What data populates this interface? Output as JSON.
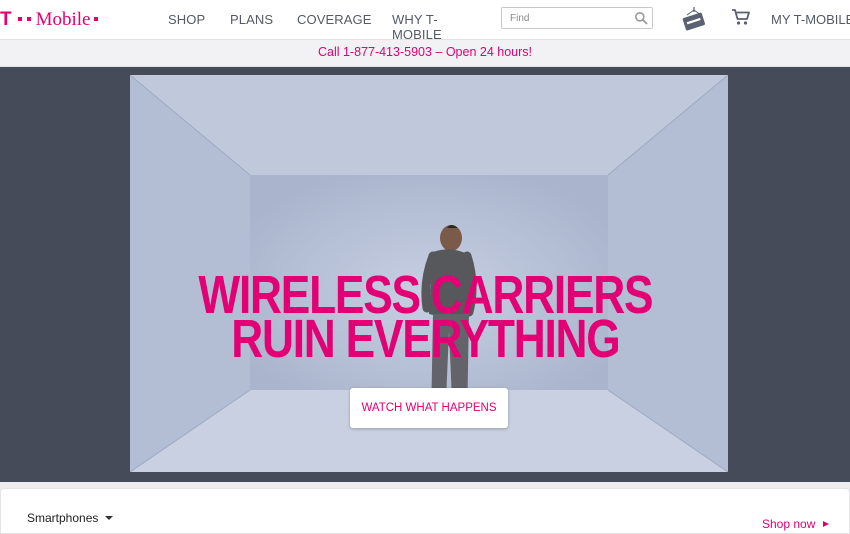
{
  "brand": {
    "logo_t": "T",
    "logo_word": "Mobile",
    "accent_color": "#e20074"
  },
  "nav": {
    "items": [
      {
        "label": "SHOP"
      },
      {
        "label": "PLANS"
      },
      {
        "label": "COVERAGE"
      },
      {
        "label": "WHY T-MOBILE"
      }
    ],
    "search_placeholder": "Find",
    "store_icon": "store-sign-icon",
    "cart_icon": "shopping-cart-icon",
    "account_label": "MY T-MOBILE"
  },
  "promo": {
    "text": "Call 1-877-413-5903 – Open 24 hours!"
  },
  "hero": {
    "headline_line1": "WIRELESS CARRIERS",
    "headline_line2": "RUIN EVERYTHING",
    "cta_label": "WATCH WHAT HAPPENS"
  },
  "bottom": {
    "dropdown_label": "Smartphones",
    "shop_now_label": "Shop now"
  }
}
